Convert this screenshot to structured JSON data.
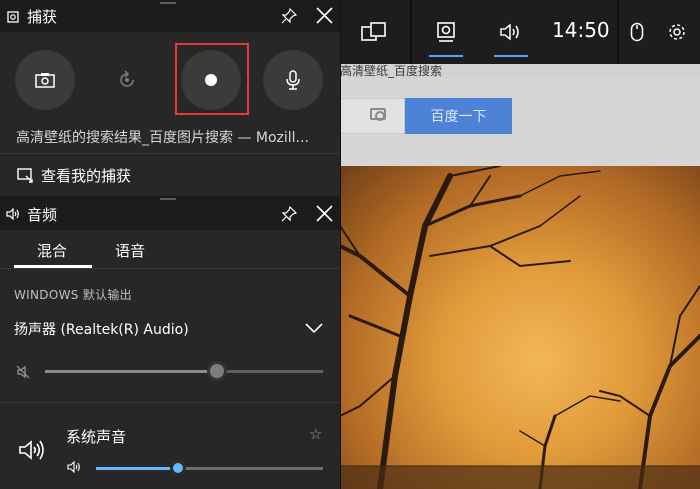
{
  "browser": {
    "title_fragment": "高清壁纸_百度搜索",
    "search_button": "百度一下"
  },
  "gamebar": {
    "clock": "14:50",
    "buttons": [
      "widget-menu",
      "capture",
      "audio",
      "mouse",
      "settings"
    ]
  },
  "capture": {
    "title": "捕获",
    "buttons": [
      "screenshot",
      "record-last",
      "start-recording",
      "microphone"
    ],
    "window_title": "高清壁纸的搜索结果_百度图片搜索 — Mozill...",
    "my_captures": "查看我的捕获"
  },
  "audio": {
    "title": "音频",
    "tabs": [
      "混合",
      "语音"
    ],
    "active_tab": "混合",
    "section_label": "WINDOWS 默认输出",
    "device": "扬声器 (Realtek(R) Audio)",
    "master_volume": 0.62,
    "app_name": "系统声音",
    "app_volume": 0.36,
    "accent_color": "#63b8ff",
    "highlight_color": "#e53935"
  }
}
